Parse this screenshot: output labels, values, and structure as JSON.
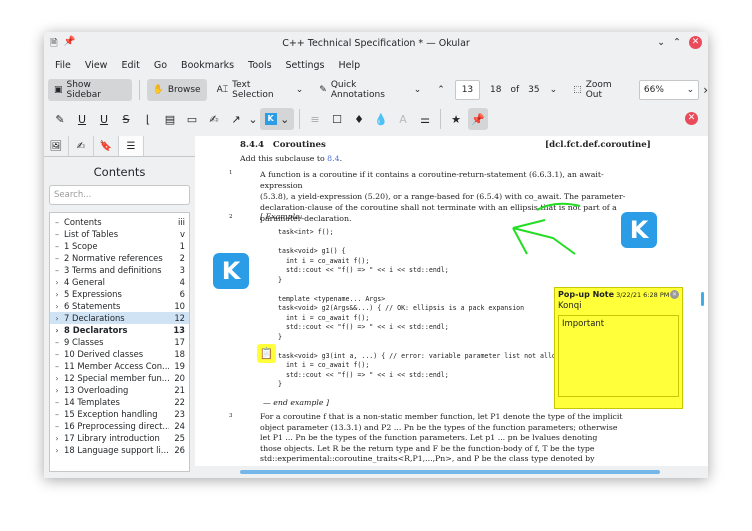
{
  "window": {
    "title": "C++ Technical Specification * — Okular"
  },
  "menu": [
    "File",
    "View",
    "Edit",
    "Go",
    "Bookmarks",
    "Tools",
    "Settings",
    "Help"
  ],
  "toolbar": {
    "show_sidebar": "Show Sidebar",
    "browse": "Browse",
    "text_selection": "Text Selection",
    "quick_annotations": "Quick Annotations",
    "page_input": "13",
    "page_label": "18",
    "of": "of",
    "total_pages": "35",
    "zoom_out": "Zoom Out",
    "zoom_value": "66%"
  },
  "sidebar": {
    "title": "Contents",
    "search_placeholder": "Search...",
    "items": [
      {
        "label": "Contents",
        "page": "iii",
        "expandable": false
      },
      {
        "label": "List of Tables",
        "page": "v",
        "expandable": false
      },
      {
        "label": "1 Scope",
        "page": "1",
        "expandable": false
      },
      {
        "label": "2 Normative references",
        "page": "2",
        "expandable": false
      },
      {
        "label": "3 Terms and definitions",
        "page": "3",
        "expandable": false
      },
      {
        "label": "4 General",
        "page": "4",
        "expandable": true
      },
      {
        "label": "5 Expressions",
        "page": "6",
        "expandable": true
      },
      {
        "label": "6 Statements",
        "page": "10",
        "expandable": true
      },
      {
        "label": "7 Declarations",
        "page": "12",
        "expandable": true,
        "selected": true
      },
      {
        "label": "8 Declarators",
        "page": "13",
        "expandable": true,
        "bold": true
      },
      {
        "label": "9 Classes",
        "page": "17",
        "expandable": false
      },
      {
        "label": "10 Derived classes",
        "page": "18",
        "expandable": false
      },
      {
        "label": "11 Member Access Con...",
        "page": "19",
        "expandable": false
      },
      {
        "label": "12 Special member fun...",
        "page": "20",
        "expandable": true
      },
      {
        "label": "13 Overloading",
        "page": "21",
        "expandable": true
      },
      {
        "label": "14 Templates",
        "page": "22",
        "expandable": false
      },
      {
        "label": "15 Exception handling",
        "page": "23",
        "expandable": false
      },
      {
        "label": "16 Preprocessing direct...",
        "page": "24",
        "expandable": false
      },
      {
        "label": "17 Library introduction",
        "page": "25",
        "expandable": true
      },
      {
        "label": "18 Language support li...",
        "page": "26",
        "expandable": true
      }
    ]
  },
  "document": {
    "section_num": "8.4.4",
    "section_title": "Coroutines",
    "section_ref": "[dcl.fct.def.coroutine]",
    "intro": "Add this subclause to",
    "intro_link": "8.4",
    "intro_end": ".",
    "p1_num": "1",
    "p1_lines": [
      "A function is a coroutine if it contains a coroutine-return-statement (6.6.3.1), an await-expression",
      "(5.3.8), a yield-expression (5.20), or a range-based for (6.5.4) with co_await. The parameter-",
      "declaration-clause of the coroutine shall not terminate with an ellipsis that is not part of a",
      "parameter-declaration."
    ],
    "p2_num": "2",
    "example_start": "[ Example:",
    "code1": [
      "task<int> f();",
      "",
      "task<void> g1() {",
      "  int i = co_await f();",
      "  std::cout << \"f() => \" << i << std::endl;",
      "}",
      "",
      "template <typename... Args>",
      "task<void> g2(Args&&...) { // OK: ellipsis is a pack expansion",
      "  int i = co_await f();",
      "  std::cout << \"f() => \" << i << std::endl;",
      "}",
      "",
      "task<void> g3(int a, ...) { // error: variable parameter list not allowed",
      "  int i = co_await f();",
      "  std::cout << \"f() => \" << i << std::endl;",
      "}"
    ],
    "example_end": "— end example ]",
    "p3_num": "3",
    "p3_lines": [
      "For a coroutine f that is a non-static member function, let P1 denote the type of the implicit",
      "object parameter (13.3.1) and P2 ... Pn be the types of the function parameters; otherwise",
      "let P1 ... Pn be the types of the function parameters. Let p1 ... pn be lvalues denoting",
      "those objects. Let R be the return type and F be the function-body of f, T be the type",
      "std::experimental::coroutine_traits<R,P1,...,Pn>, and P be the class type denoted by"
    ]
  },
  "popup_note": {
    "title": "Pop-up Note",
    "date": "3/22/21 6:28 PM",
    "author": "Konqi",
    "text": "Important"
  },
  "colors": {
    "highlight": "#ffff3a",
    "accent": "#3daee9",
    "freehand": "#22dd22",
    "close": "#e94b5b"
  }
}
